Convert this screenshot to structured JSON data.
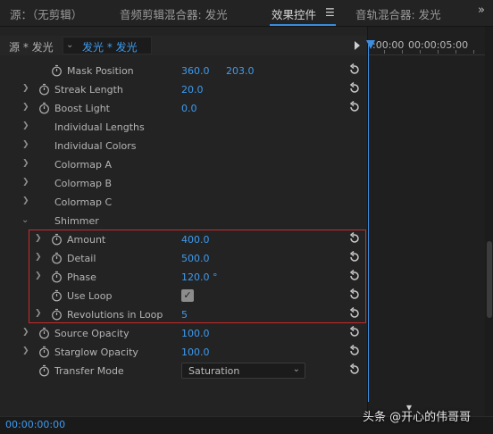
{
  "tabs": [
    {
      "label": "源：（无剪辑）"
    },
    {
      "label": "音频剪辑混合器: 发光"
    },
    {
      "label": "效果控件"
    },
    {
      "label": "音轨混合器: 发光"
    }
  ],
  "tab_overflow": "»",
  "source": {
    "label": "源 * 发光",
    "clip": "发光 * 发光"
  },
  "ruler": {
    "start": ":00:00",
    "end": "00:00:05:00"
  },
  "properties": {
    "mask_position": {
      "label": "Mask Position",
      "x": "360.0",
      "y": "203.0"
    },
    "streak_length": {
      "label": "Streak Length",
      "value": "20.0"
    },
    "boost_light": {
      "label": "Boost Light",
      "value": "0.0"
    },
    "individual_lengths": {
      "label": "Individual Lengths"
    },
    "individual_colors": {
      "label": "Individual Colors"
    },
    "colormap_a": {
      "label": "Colormap A"
    },
    "colormap_b": {
      "label": "Colormap B"
    },
    "colormap_c": {
      "label": "Colormap C"
    },
    "shimmer": {
      "label": "Shimmer"
    },
    "amount": {
      "label": "Amount",
      "value": "400.0"
    },
    "detail": {
      "label": "Detail",
      "value": "500.0"
    },
    "phase": {
      "label": "Phase",
      "value": "120.0 °"
    },
    "use_loop": {
      "label": "Use Loop",
      "checked": true
    },
    "revolutions": {
      "label": "Revolutions in Loop",
      "value": "5"
    },
    "source_opacity": {
      "label": "Source Opacity",
      "value": "100.0"
    },
    "starglow_opacity": {
      "label": "Starglow Opacity",
      "value": "100.0"
    },
    "transfer_mode": {
      "label": "Transfer Mode",
      "value": "Saturation"
    }
  },
  "footer": {
    "timecode": "00:00:00:00"
  },
  "watermark": "头条 @开心的伟哥哥",
  "colors": {
    "accent": "#3e9bf0",
    "highlight": "#cc2a2a",
    "panel": "#232323"
  }
}
